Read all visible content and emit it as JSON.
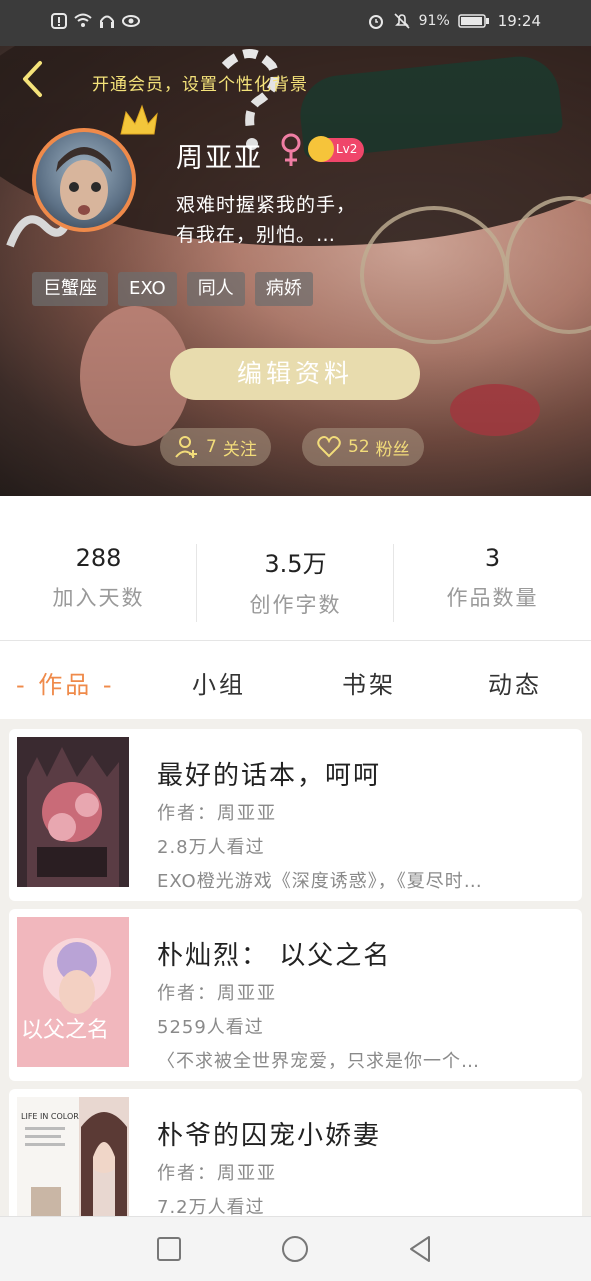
{
  "status_bar": {
    "battery": "91%",
    "time": "19:24"
  },
  "header": {
    "vip_prompt": "开通会员，设置个性化背景"
  },
  "profile": {
    "name": "周亚亚",
    "level": "Lv2",
    "bio_line1": "艰难时握紧我的手，",
    "bio_line2": "有我在，别怕。…",
    "tags": [
      "巨蟹座",
      "EXO",
      "同人",
      "病娇"
    ],
    "edit_label": "编辑资料",
    "following_count": "7",
    "following_label": "关注",
    "followers_count": "52",
    "followers_label": "粉丝"
  },
  "stats": [
    {
      "value": "288",
      "label": "加入天数"
    },
    {
      "value": "3.5万",
      "label": "创作字数"
    },
    {
      "value": "3",
      "label": "作品数量"
    }
  ],
  "tabs": [
    {
      "label": "- 作品 -",
      "active": true
    },
    {
      "label": "小组"
    },
    {
      "label": "书架"
    },
    {
      "label": "动态"
    }
  ],
  "works": [
    {
      "title": "最好的话本，呵呵",
      "author": "作者：周亚亚",
      "views": "2.8万人看过",
      "desc": "EXO橙光游戏《深度诱惑》，《夏尽时…"
    },
    {
      "title": "朴灿烈： 以父之名",
      "author": "作者：周亚亚",
      "views": "5259人看过",
      "desc": "〈不求被全世界宠爱，只求是你一个…"
    },
    {
      "title": "朴爷的囚宠小娇妻",
      "author": "作者：周亚亚",
      "views": "7.2万人看过",
      "desc": ""
    }
  ],
  "cover_text": {
    "cover2_text": "以父之名",
    "cover3_text": "LIFE IN COLOR"
  },
  "colors": {
    "accent": "#ef8a4a",
    "edit_button": "#e8dcae",
    "vip_text": "#f4e27a"
  }
}
